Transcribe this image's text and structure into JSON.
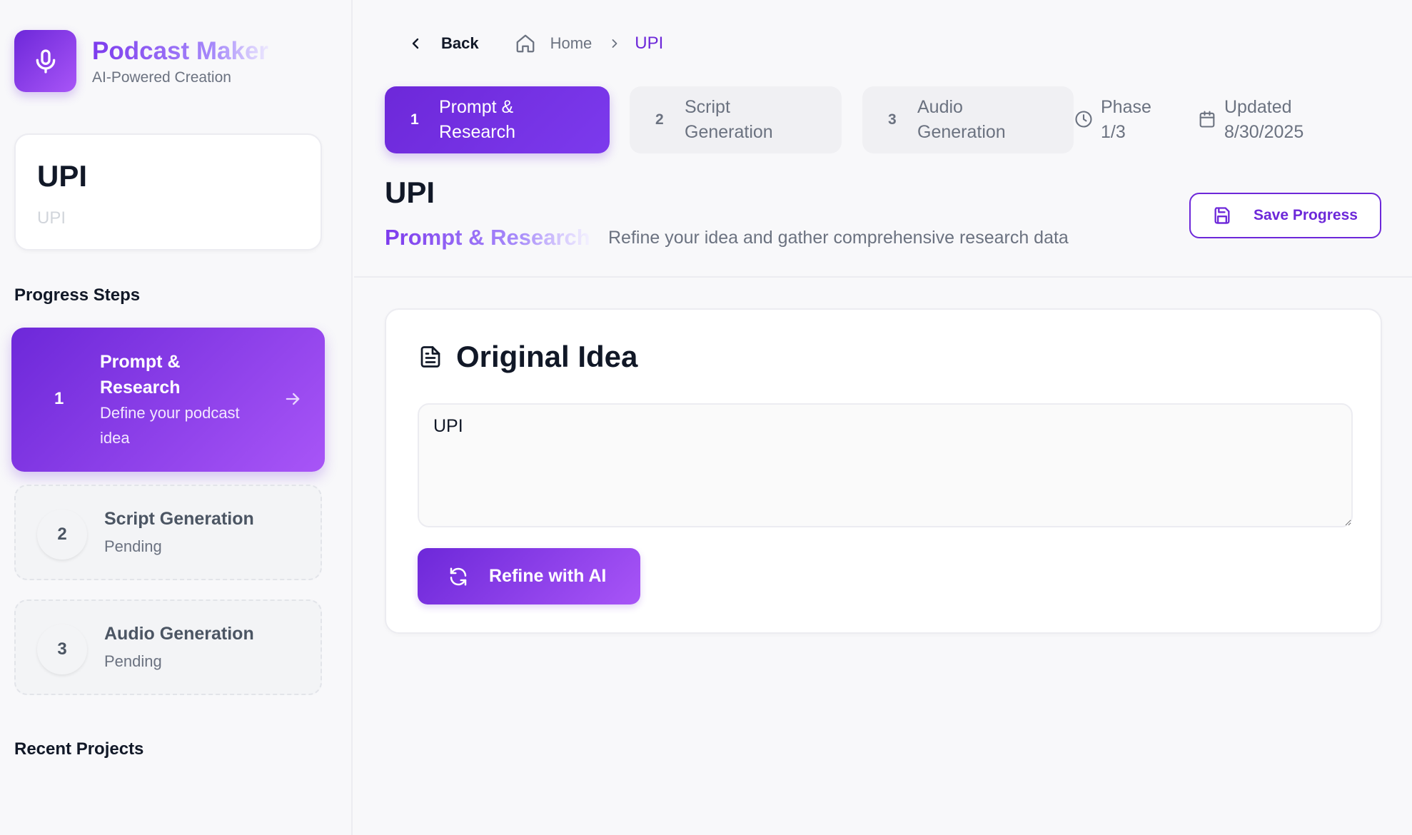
{
  "brand": {
    "title": "Podcast Maker",
    "subtitle": "AI-Powered Creation",
    "icon": "microphone-icon"
  },
  "project_card": {
    "title": "UPI",
    "subtitle": "UPI"
  },
  "sidebar": {
    "progress_title": "Progress Steps",
    "steps": [
      {
        "number": "1",
        "name": "Prompt & Research",
        "description": "Define your podcast idea",
        "state": "active"
      },
      {
        "number": "2",
        "name": "Script Generation",
        "description": "Pending",
        "state": "pending"
      },
      {
        "number": "3",
        "name": "Audio Generation",
        "description": "Pending",
        "state": "pending"
      }
    ],
    "recent_title": "Recent Projects"
  },
  "nav": {
    "back_label": "Back",
    "breadcrumb": {
      "home": "Home",
      "current": "UPI"
    }
  },
  "phases": [
    {
      "number": "1",
      "label": "Prompt & Research",
      "active": true
    },
    {
      "number": "2",
      "label": "Script Generation",
      "active": false
    },
    {
      "number": "3",
      "label": "Audio Generation",
      "active": false
    }
  ],
  "meta": {
    "phase": "Phase 1/3",
    "updated": "Updated 8/30/2025"
  },
  "header": {
    "title": "UPI",
    "phase_name": "Prompt & Research",
    "description": "Refine your idea and gather comprehensive research data",
    "save_label": "Save Progress"
  },
  "idea": {
    "title": "Original Idea",
    "value": "UPI",
    "refine_label": "Refine with AI"
  },
  "colors": {
    "accent": "#6d28d9",
    "accent_light": "#a855f7",
    "muted": "#6b7280",
    "background": "#f8f8fa"
  }
}
